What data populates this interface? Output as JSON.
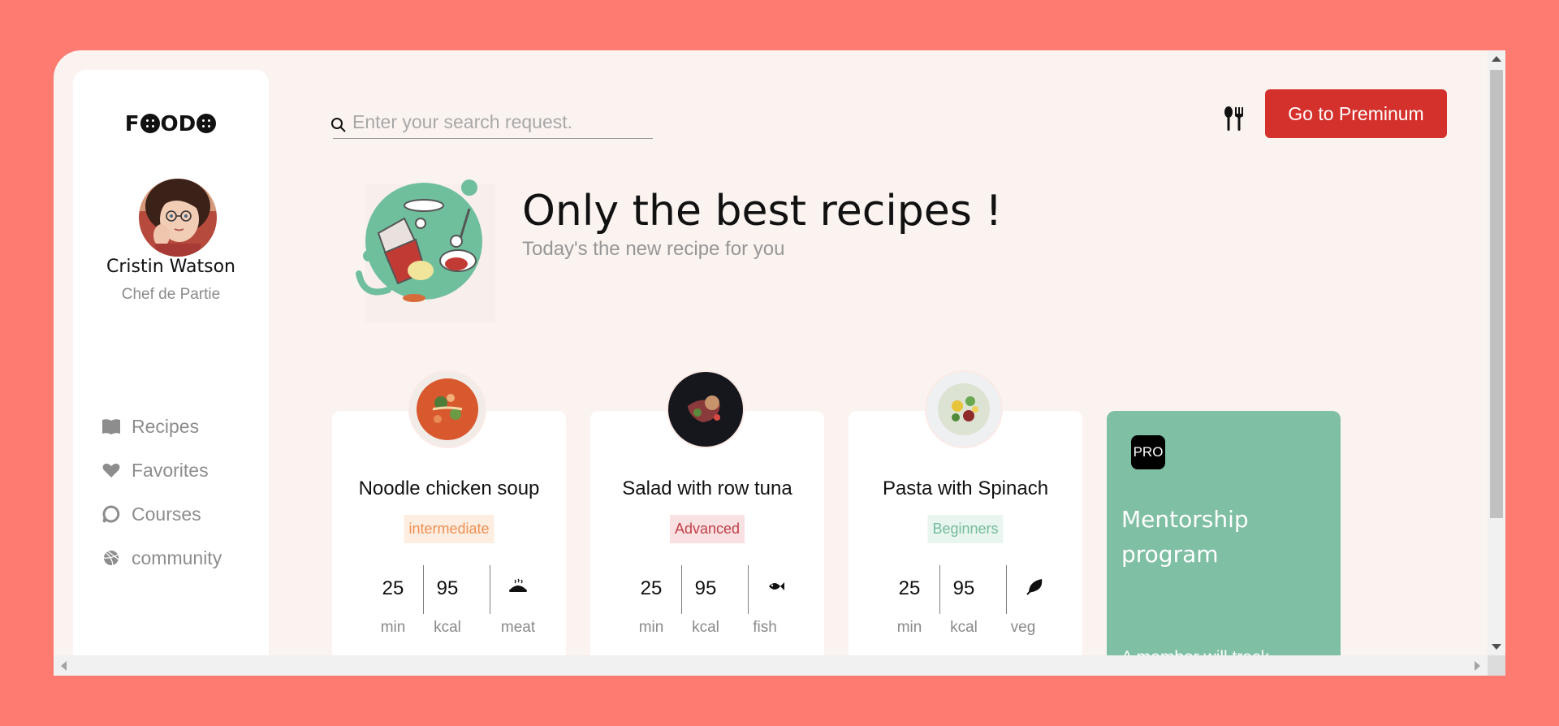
{
  "app": {
    "logo": {
      "left": "F",
      "middle": "OD"
    }
  },
  "sidebar": {
    "profile": {
      "name": "Cristin Watson",
      "role": "Chef de Partie"
    },
    "items": [
      {
        "label": "Recipes",
        "icon": "book-icon"
      },
      {
        "label": "Favorites",
        "icon": "heart-icon"
      },
      {
        "label": "Courses",
        "icon": "chat-bubble-icon"
      },
      {
        "label": "community",
        "icon": "dribbble-icon"
      }
    ]
  },
  "header": {
    "search_placeholder": "Enter your search request.",
    "premium_label": "Go to Preminum"
  },
  "hero": {
    "title": "Only the best recipes !",
    "subtitle": "Today's the new recipe for you"
  },
  "recipes": [
    {
      "title": "Noodle chicken soup",
      "level": "intermediate",
      "level_color": "#ee8f52",
      "level_bg": "#fdeee1",
      "time": "25",
      "time_unit": "min",
      "kcal": "95",
      "kcal_unit": "kcal",
      "category": "meat",
      "category_icon": "roast-chicken-icon"
    },
    {
      "title": "Salad with row tuna",
      "level": "Advanced",
      "level_color": "#c1404a",
      "level_bg": "#f9e0e1",
      "time": "25",
      "time_unit": "min",
      "kcal": "95",
      "kcal_unit": "kcal",
      "category": "fish",
      "category_icon": "fish-icon"
    },
    {
      "title": "Pasta with Spinach",
      "level": "Beginners",
      "level_color": "#74bb9b",
      "level_bg": "#e9f6ef",
      "time": "25",
      "time_unit": "min",
      "kcal": "95",
      "kcal_unit": "kcal",
      "category": "veg",
      "category_icon": "leaf-icon"
    }
  ],
  "promo": {
    "badge": "PRO",
    "title": "Mentorship program",
    "description": "A member will track"
  }
}
